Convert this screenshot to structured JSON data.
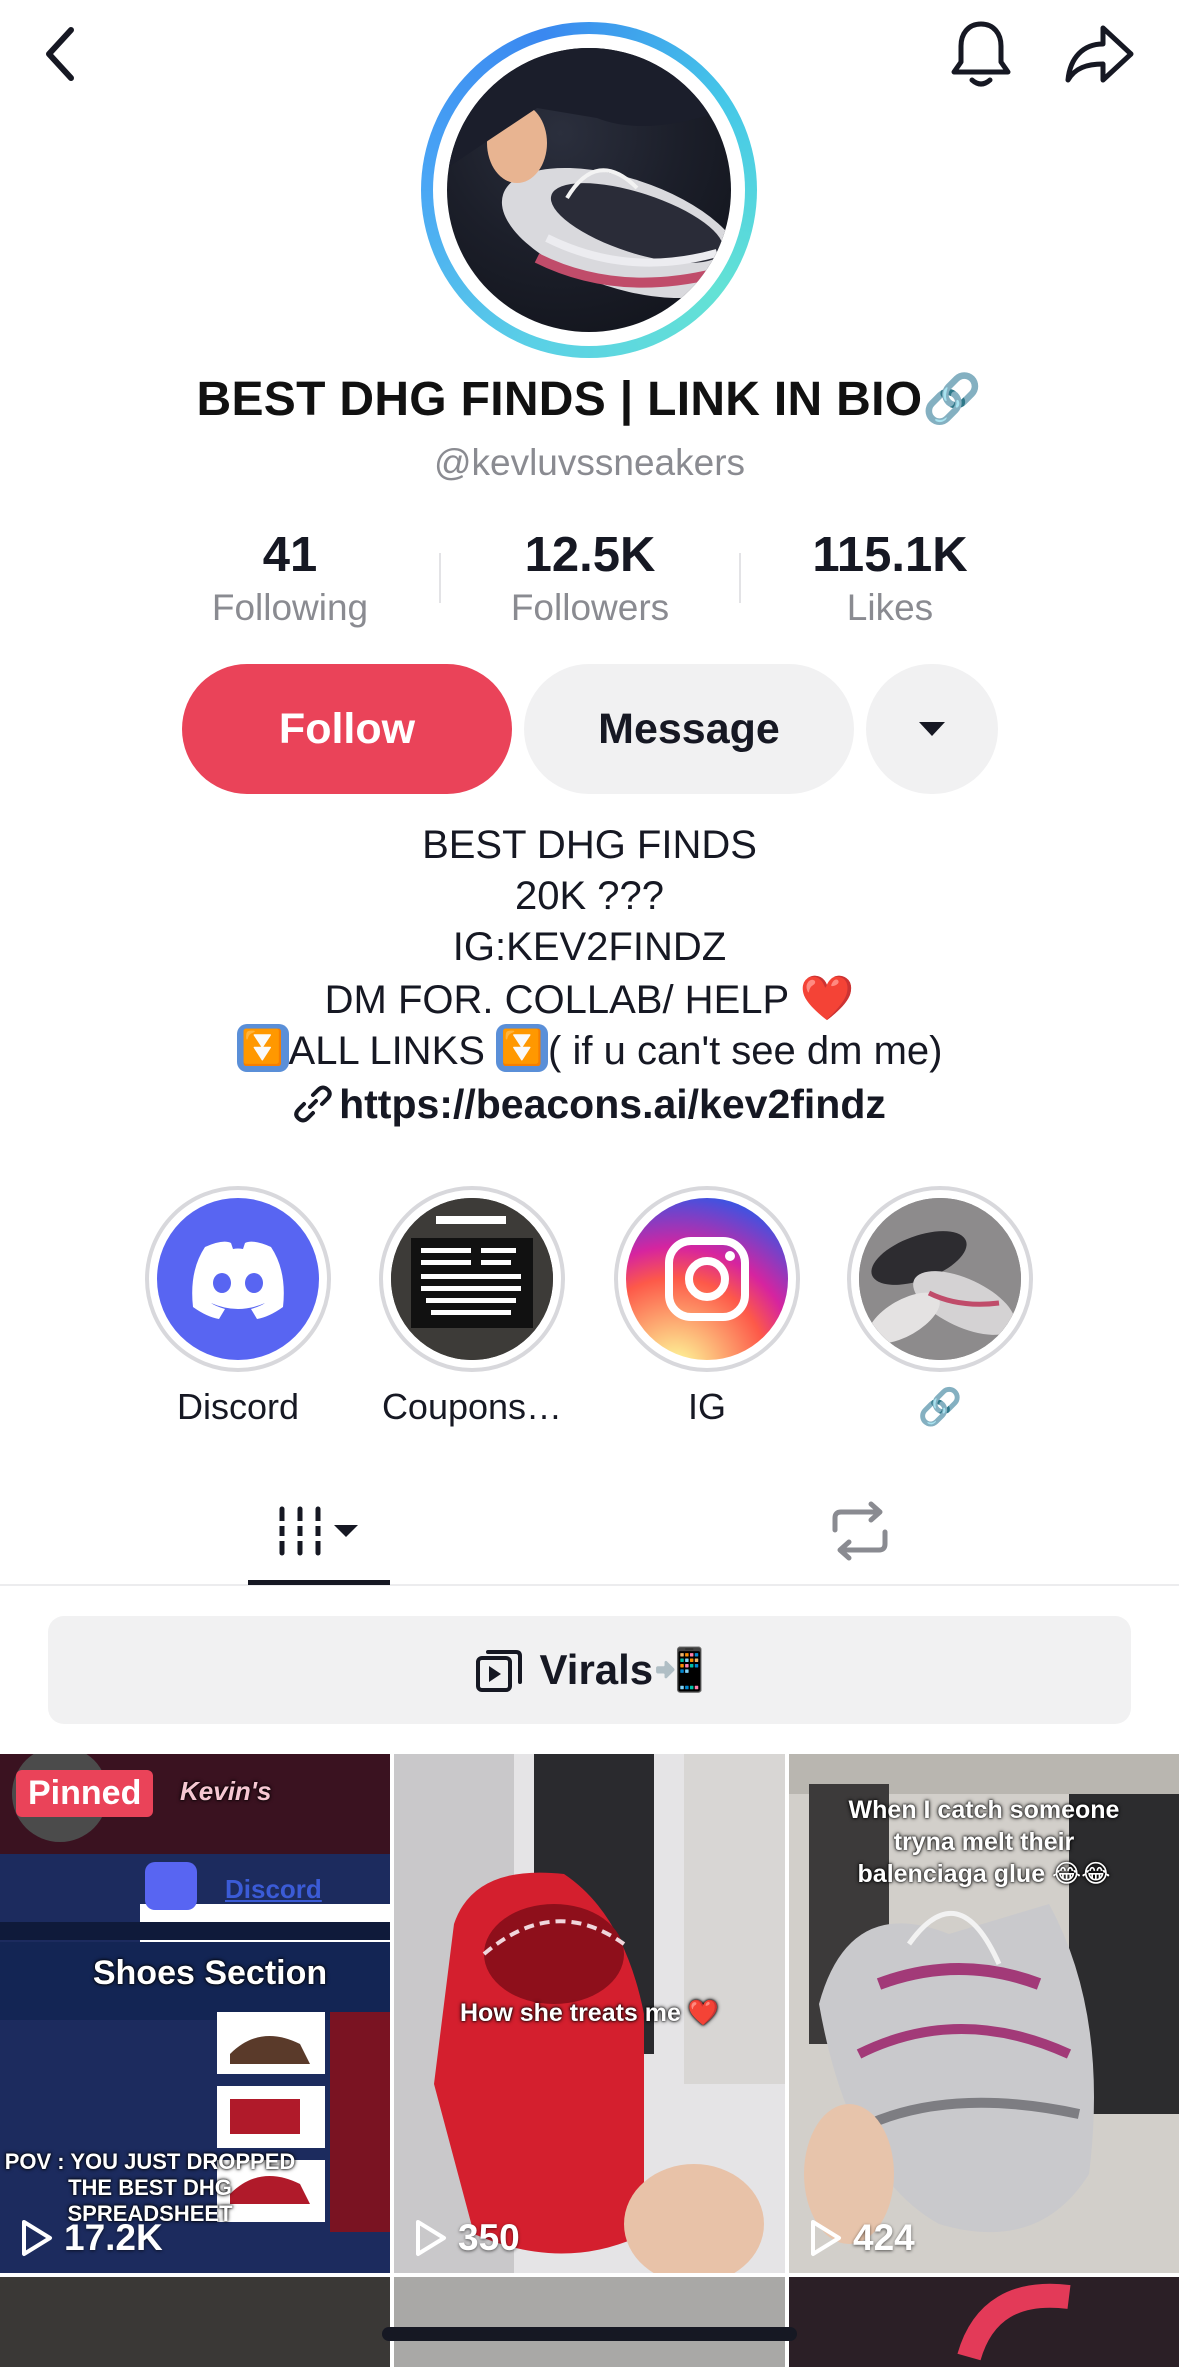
{
  "profile": {
    "display_name": "BEST DHG FINDS | LINK IN BIO🔗",
    "handle": "@kevluvssneakers",
    "stats": [
      {
        "value": "41",
        "label": "Following"
      },
      {
        "value": "12.5K",
        "label": "Followers"
      },
      {
        "value": "115.1K",
        "label": "Likes"
      }
    ],
    "actions": {
      "follow": "Follow",
      "message": "Message"
    },
    "bio": {
      "line1": "BEST DHG FINDS",
      "line2": "20K ???",
      "line3": "IG:KEV2FINDZ",
      "line4": "DM FOR. COLLAB/ HELP",
      "line4_emoji": "❤️",
      "line5_a": "ALL LINKS",
      "line5_b": "( if u can't see dm me)",
      "link": "https://beacons.ai/kev2findz"
    }
  },
  "highlights": [
    {
      "label": "Discord",
      "icon": "discord-icon"
    },
    {
      "label": "Coupons…",
      "icon": "coupon-image"
    },
    {
      "label": "IG",
      "icon": "instagram-icon"
    },
    {
      "label": "🔗",
      "icon": "sneaker-image"
    }
  ],
  "tabs": {
    "videos_icon": "grid-icon",
    "repost_icon": "repost-icon"
  },
  "playlist": {
    "label": "Virals📲"
  },
  "videos": [
    {
      "views": "17.2K",
      "pinned": "Pinned",
      "caption": "POV : YOU JUST DROPPED THE BEST DHG SPREADSHEET",
      "section": "Shoes Section",
      "brand": "Kevin's",
      "discord": "Discord"
    },
    {
      "views": "350",
      "caption": "How she treats me ❤️"
    },
    {
      "views": "424",
      "caption": "When I catch someone tryna melt their balenciaga glue 😂😂"
    }
  ],
  "colors": {
    "accent": "#ea4359",
    "muted": "#8a8b91",
    "text": "#161823"
  }
}
